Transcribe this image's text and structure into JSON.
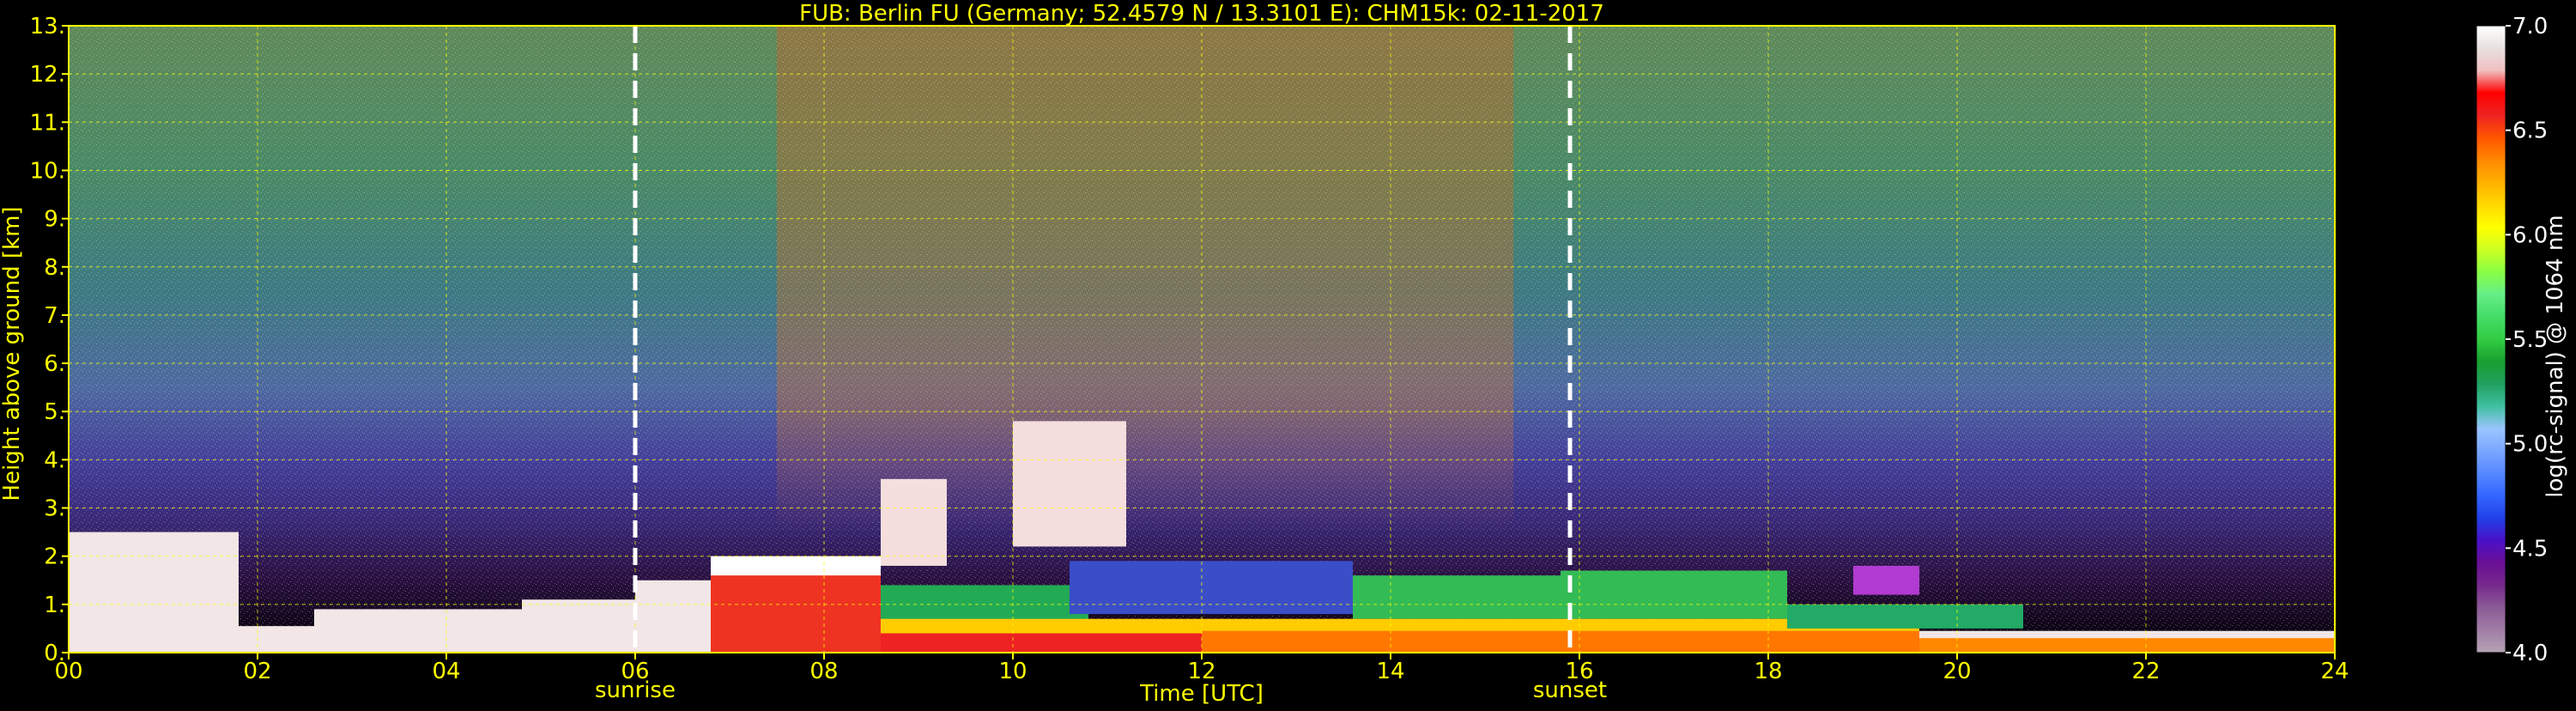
{
  "chart_data": {
    "type": "heatmap",
    "title": "FUB: Berlin FU (Germany; 52.4579 N / 13.3101 E):    CHM15k: 02-11-2017",
    "xlabel": "Time [UTC]",
    "ylabel": "Height above ground [km]",
    "xlim": [
      0,
      24
    ],
    "ylim": [
      0,
      13
    ],
    "x_ticks": [
      "00",
      "02",
      "04",
      "06",
      "08",
      "10",
      "12",
      "14",
      "16",
      "18",
      "20",
      "22",
      "24"
    ],
    "y_ticks": [
      "0.",
      "1.",
      "2.",
      "3.",
      "4.",
      "5.",
      "6.",
      "7.",
      "8.",
      "9.",
      "10.",
      "11.",
      "12.",
      "13."
    ],
    "grid": true,
    "annotations": [
      {
        "label": "sunrise",
        "x": 6.0
      },
      {
        "label": "sunset",
        "x": 15.9
      }
    ],
    "colorbar": {
      "label": "log(rc-signal) @ 1064 nm",
      "range": [
        4.0,
        7.0
      ],
      "ticks": [
        "4.0",
        "4.5",
        "5.0",
        "5.5",
        "6.0",
        "6.5",
        "7.0"
      ],
      "colors": [
        "#b5a4b5",
        "#a07ea5",
        "#8b5a95",
        "#772a8d",
        "#6a0f95",
        "#4a10c8",
        "#2040e6",
        "#3366ff",
        "#5588ff",
        "#7aa6ff",
        "#9ac4ff",
        "#40c0a0",
        "#20a060",
        "#18a030",
        "#33cc44",
        "#44dd66",
        "#66ee88",
        "#88ff44",
        "#ccff22",
        "#ffff00",
        "#ffd800",
        "#ffb000",
        "#ff8800",
        "#ff5500",
        "#ee2222",
        "#ff0000",
        "#f0c0c0",
        "#e8e0e0",
        "#ffffff"
      ]
    },
    "background_profile": [
      {
        "h": 0.0,
        "color": "#000000"
      },
      {
        "h": 1.5,
        "color": "#2a1040"
      },
      {
        "h": 2.8,
        "color": "#3a2a7a"
      },
      {
        "h": 4.0,
        "color": "#44409a"
      },
      {
        "h": 5.5,
        "color": "#4e6aa0"
      },
      {
        "h": 7.5,
        "color": "#3d7a82"
      },
      {
        "h": 10.0,
        "color": "#4a8a66"
      },
      {
        "h": 13.0,
        "color": "#608a5a"
      }
    ],
    "signal_regions": [
      {
        "name": "surface-aerosol-white",
        "x0": 0.0,
        "x1": 1.8,
        "y0": 0.0,
        "y1": 2.5,
        "color": "#f2e6e6"
      },
      {
        "name": "surface-aerosol-white",
        "x0": 1.8,
        "x1": 2.6,
        "y0": 0.0,
        "y1": 0.55,
        "color": "#f2e6e6"
      },
      {
        "name": "surface-aerosol-white",
        "x0": 2.6,
        "x1": 4.8,
        "y0": 0.0,
        "y1": 0.9,
        "color": "#f2e6e6"
      },
      {
        "name": "surface-aerosol-white",
        "x0": 4.8,
        "x1": 6.0,
        "y0": 0.0,
        "y1": 1.1,
        "color": "#f2e6e6"
      },
      {
        "name": "surface-aerosol-white",
        "x0": 6.0,
        "x1": 6.8,
        "y0": 0.0,
        "y1": 1.5,
        "color": "#f2e6e6"
      },
      {
        "name": "pbl-red",
        "x0": 6.8,
        "x1": 8.6,
        "y0": 0.0,
        "y1": 1.9,
        "color": "#ee3322"
      },
      {
        "name": "pbl-white-top",
        "x0": 6.8,
        "x1": 8.6,
        "y0": 1.6,
        "y1": 2.0,
        "color": "#ffffff"
      },
      {
        "name": "cloud-plume-white",
        "x0": 8.6,
        "x1": 9.3,
        "y0": 1.8,
        "y1": 3.6,
        "color": "#f4dede"
      },
      {
        "name": "cloud-plume-white",
        "x0": 10.0,
        "x1": 11.2,
        "y0": 2.2,
        "y1": 4.8,
        "color": "#f4dede"
      },
      {
        "name": "boundary-layer-green",
        "x0": 8.6,
        "x1": 10.8,
        "y0": 0.6,
        "y1": 1.4,
        "color": "#22aa55"
      },
      {
        "name": "boundary-layer-blue",
        "x0": 10.6,
        "x1": 13.6,
        "y0": 0.8,
        "y1": 1.9,
        "color": "#3a4ec8"
      },
      {
        "name": "boundary-layer-green",
        "x0": 13.6,
        "x1": 15.8,
        "y0": 0.7,
        "y1": 1.6,
        "color": "#33bb55"
      },
      {
        "name": "boundary-layer-green",
        "x0": 15.8,
        "x1": 18.2,
        "y0": 0.7,
        "y1": 1.7,
        "color": "#33bb55"
      },
      {
        "name": "boundary-layer-yellow",
        "x0": 8.6,
        "x1": 19.6,
        "y0": 0.1,
        "y1": 0.7,
        "color": "#ffcc00"
      },
      {
        "name": "boundary-layer-red",
        "x0": 8.6,
        "x1": 12.0,
        "y0": 0.0,
        "y1": 0.4,
        "color": "#ee2222"
      },
      {
        "name": "boundary-layer-orange",
        "x0": 12.0,
        "x1": 19.6,
        "y0": 0.0,
        "y1": 0.45,
        "color": "#ff7700"
      },
      {
        "name": "evening-layer-green",
        "x0": 18.2,
        "x1": 20.7,
        "y0": 0.5,
        "y1": 1.0,
        "color": "#22aa66"
      },
      {
        "name": "evening-layer-magenta",
        "x0": 18.9,
        "x1": 19.6,
        "y0": 1.2,
        "y1": 1.8,
        "color": "#b03bd0"
      },
      {
        "name": "night-layer-orange",
        "x0": 19.6,
        "x1": 24.0,
        "y0": 0.0,
        "y1": 0.35,
        "color": "#ff8800"
      },
      {
        "name": "night-layer-white",
        "x0": 19.6,
        "x1": 24.0,
        "y0": 0.3,
        "y1": 0.45,
        "color": "#f2e6e6"
      }
    ]
  }
}
